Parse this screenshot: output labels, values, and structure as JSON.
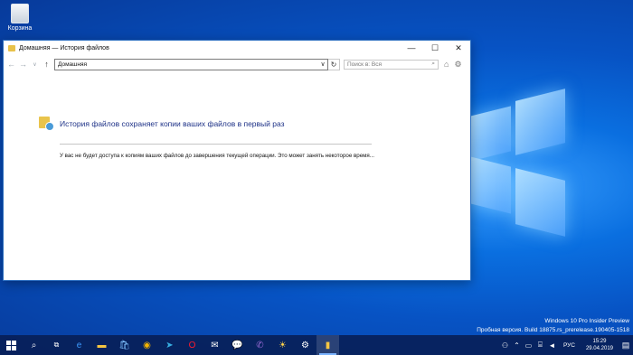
{
  "desktop": {
    "recycle_bin_label": "Корзина"
  },
  "window": {
    "title": "Домашняя — История файлов",
    "controls": {
      "minimize": "—",
      "maximize": "☐",
      "close": "✕"
    },
    "address": "Домашняя",
    "search_placeholder": "Поиск в: Вся",
    "heading": "История файлов сохраняет копии ваших файлов в первый раз",
    "message": "У вас не будет доступа к копиям ваших файлов до завершения текущей операции. Это может занять некоторое время..."
  },
  "watermark": {
    "line1": "Windows 10 Pro Insider Preview",
    "line2": "Пробная версия. Build 18875.rs_prerelease.190405-1518"
  },
  "taskbar": {
    "apps": [
      "start",
      "search",
      "task-view",
      "edge",
      "file-explorer",
      "store",
      "chrome",
      "telegram",
      "opera",
      "mail",
      "messaging",
      "viber",
      "weather",
      "settings",
      "file-history"
    ],
    "language": "РУС",
    "time": "15:29",
    "date": "29.04.2019"
  }
}
